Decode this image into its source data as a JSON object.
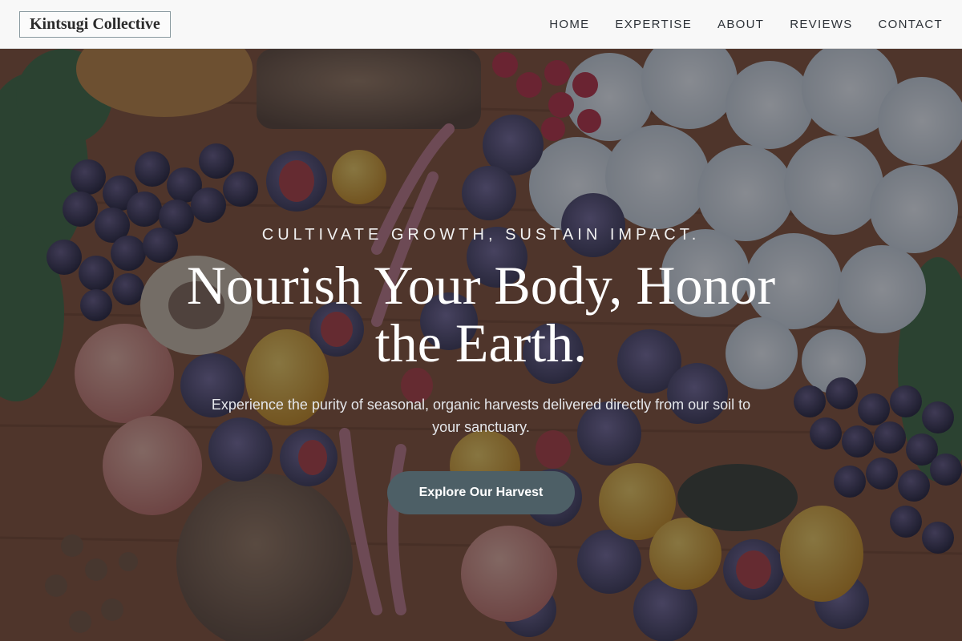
{
  "brand": {
    "name": "Kintsugi Collective"
  },
  "nav": {
    "items": [
      {
        "label": "HOME"
      },
      {
        "label": "EXPERTISE"
      },
      {
        "label": "ABOUT"
      },
      {
        "label": "REVIEWS"
      },
      {
        "label": "CONTACT"
      }
    ]
  },
  "hero": {
    "background": "background-photo",
    "tagline": "CULTIVATE GROWTH, SUSTAIN IMPACT.",
    "headline": "Nourish Your Body, Honor the Earth.",
    "subtext": "Experience the purity of seasonal, organic harvests delivered directly from our soil to your sanctuary.",
    "cta_label": "Explore Our Harvest"
  },
  "colors": {
    "header_bg": "#f8f8f8",
    "cta_bg": "#4d5f66",
    "overlay": "#181e2a"
  }
}
